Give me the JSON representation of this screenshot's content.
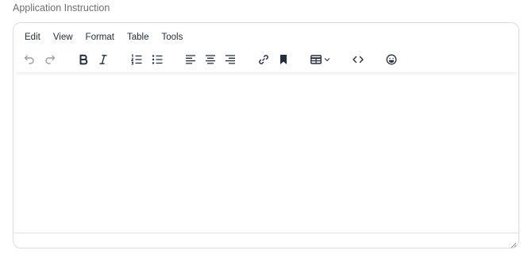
{
  "field": {
    "label": "Application Instruction"
  },
  "menubar": {
    "items": [
      "Edit",
      "View",
      "Format",
      "Table",
      "Tools"
    ]
  },
  "editor": {
    "content": ""
  },
  "colors": {
    "icon": "#222f3e",
    "icon_disabled": "#8a9099",
    "border": "#dcdcdc",
    "label": "#6f6f6f"
  },
  "toolbar": {
    "icons": [
      "undo-icon",
      "redo-icon",
      "bold-icon",
      "italic-icon",
      "numbered-list-icon",
      "bullet-list-icon",
      "align-left-icon",
      "align-center-icon",
      "align-right-icon",
      "link-icon",
      "bookmark-icon",
      "table-icon",
      "source-code-icon",
      "emoji-icon"
    ]
  }
}
